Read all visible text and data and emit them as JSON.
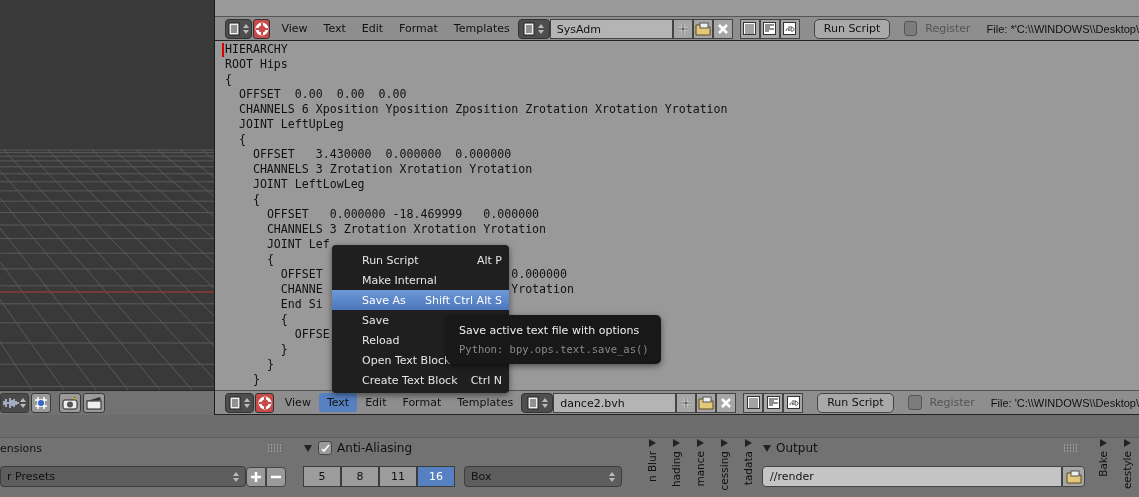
{
  "text_editor": {
    "top_header": {
      "menus": [
        {
          "label": "View",
          "selected": false
        },
        {
          "label": "Text",
          "selected": false
        },
        {
          "label": "Edit",
          "selected": false
        },
        {
          "label": "Format",
          "selected": false
        },
        {
          "label": "Templates",
          "selected": false
        }
      ],
      "text_block": "SysAdm",
      "run_button": "Run Script",
      "register": {
        "label": "Register",
        "checked": false,
        "disabled": true
      },
      "file_path": "File: *'C:\\\\WINDOWS\\\\Desktop\\"
    },
    "lines": [
      {
        "text": "HIERARCHY"
      },
      {
        "text": "ROOT Hips"
      },
      {
        "text": "{"
      },
      {
        "text": "  OFFSET  0.00  0.00  0.00"
      },
      {
        "text": "  CHANNELS 6 Xposition Yposition Zposition Zrotation Xrotation Yrotation"
      },
      {
        "text": "  JOINT LeftUpLeg"
      },
      {
        "text": "  {"
      },
      {
        "text": "    OFFSET   3.430000  0.000000  0.000000"
      },
      {
        "text": "    CHANNELS 3 Zrotation Xrotation Yrotation"
      },
      {
        "text": "    JOINT LeftLowLeg"
      },
      {
        "text": "    {"
      },
      {
        "text": "      OFFSET   0.000000 -18.469999   0.000000"
      },
      {
        "text": "      CHANNELS 3 Zrotation Xrotation Yrotation"
      },
      {
        "text": "      JOINT Lef"
      },
      {
        "text": "      {"
      },
      {
        "text": "        OFFSET",
        "tail": "0.000000"
      },
      {
        "text": "        CHANNE",
        "tail": "Yrotation"
      },
      {
        "text": "        End Si"
      },
      {
        "text": "        {"
      },
      {
        "text": "          OFFSE"
      },
      {
        "text": "        }"
      },
      {
        "text": "      }"
      },
      {
        "text": "    }"
      }
    ],
    "menu": {
      "items": [
        {
          "label": "Run Script",
          "shortcut": "Alt P",
          "selected": false
        },
        {
          "label": "Make Internal",
          "selected": false
        },
        {
          "label": "Save As",
          "shortcut": "Shift Ctrl Alt S",
          "selected": true
        },
        {
          "label": "Save",
          "selected": false
        },
        {
          "label": "Reload",
          "selected": false
        },
        {
          "label": "Open Text Block",
          "selected": false
        },
        {
          "label": "Create Text Block",
          "shortcut": "Ctrl N",
          "selected": false
        }
      ]
    },
    "tooltip": {
      "title": "Save active text file with options",
      "python": "Python: bpy.ops.text.save_as()"
    },
    "bottom_header": {
      "menus": [
        {
          "label": "View",
          "selected": false
        },
        {
          "label": "Text",
          "selected": true
        },
        {
          "label": "Edit",
          "selected": false
        },
        {
          "label": "Format",
          "selected": false
        },
        {
          "label": "Templates",
          "selected": false
        }
      ],
      "text_block": "dance2.bvh",
      "run_button": "Run Script",
      "register": {
        "label": "Register",
        "checked": false,
        "disabled": true
      },
      "file_path": "File: 'C:\\\\WINDOWS\\\\Desktop\\"
    }
  },
  "properties": {
    "dimensions": {
      "header": "ensions",
      "presets": "r Presets"
    },
    "anti_aliasing": {
      "label": "Anti-Aliasing",
      "checked": true,
      "expanded": true,
      "samples": [
        {
          "label": "5",
          "selected": false
        },
        {
          "label": "8",
          "selected": false
        },
        {
          "label": "11",
          "selected": false
        },
        {
          "label": "16",
          "selected": true
        }
      ],
      "filter": "Box"
    },
    "collapsed_tabs": [
      {
        "label": "n Blur",
        "expanded": false
      },
      {
        "label": "hading",
        "expanded": false
      },
      {
        "label": "mance",
        "expanded": false
      },
      {
        "label": "cessing",
        "expanded": false
      },
      {
        "label": "tadata",
        "expanded": false
      }
    ],
    "output": {
      "label": "Output",
      "expanded": true,
      "path": "//render"
    },
    "right_tabs": [
      {
        "label": "Bake",
        "expanded": false
      },
      {
        "label": "eestyle",
        "expanded": false
      }
    ]
  }
}
